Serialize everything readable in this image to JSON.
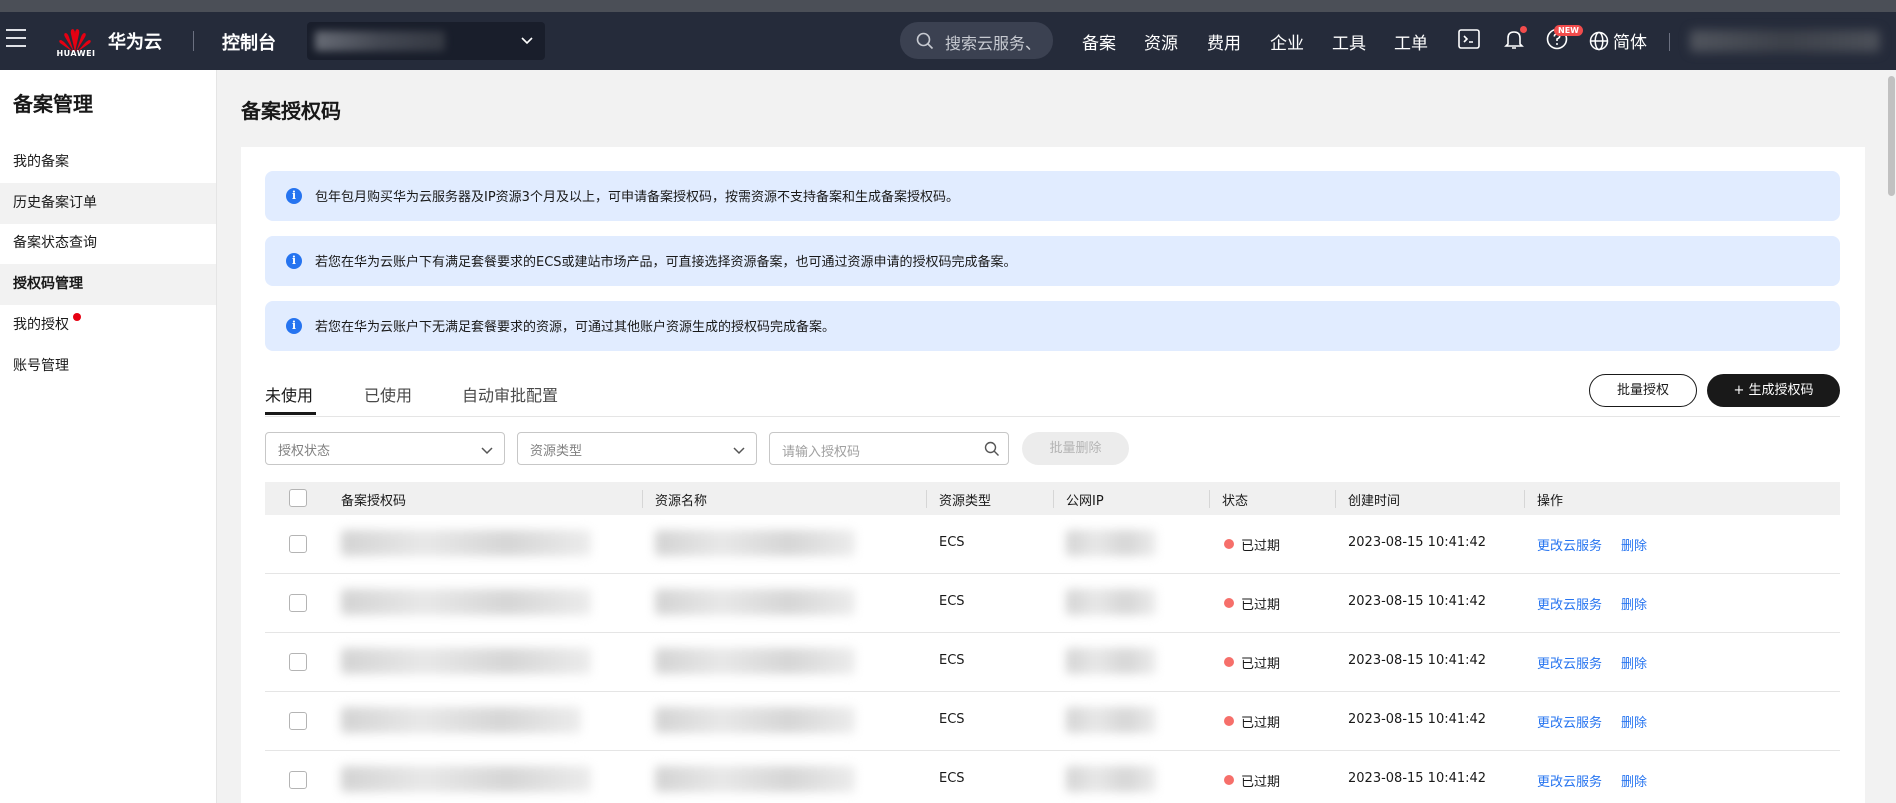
{
  "header": {
    "brand": "华为云",
    "logo_text": "HUAWEI",
    "console": "控制台",
    "search_placeholder": "搜索云服务、",
    "nav": [
      "备案",
      "资源",
      "费用",
      "企业",
      "工具",
      "工单"
    ],
    "new_badge": "NEW",
    "language": "简体"
  },
  "sidebar": {
    "title": "备案管理",
    "items": [
      {
        "label": "我的备案"
      },
      {
        "label": "历史备案订单"
      },
      {
        "label": "备案状态查询"
      },
      {
        "label": "授权码管理"
      },
      {
        "label": "我的授权"
      },
      {
        "label": "账号管理"
      }
    ]
  },
  "main": {
    "title": "备案授权码",
    "banners": [
      "包年包月购买华为云服务器及IP资源3个月及以上，可申请备案授权码，按需资源不支持备案和生成备案授权码。",
      "若您在华为云账户下有满足套餐要求的ECS或建站市场产品，可直接选择资源备案，也可通过资源申请的授权码完成备案。",
      "若您在华为云账户下无满足套餐要求的资源，可通过其他账户资源生成的授权码完成备案。"
    ],
    "info_glyph": "i",
    "tabs": [
      "未使用",
      "已使用",
      "自动审批配置"
    ],
    "batch_authorize": "批量授权",
    "generate_code": "+ 生成授权码",
    "filter_status": "授权状态",
    "filter_type": "资源类型",
    "code_input_placeholder": "请输入授权码",
    "batch_delete": "批量删除",
    "table": {
      "columns": [
        "备案授权码",
        "资源名称",
        "资源类型",
        "公网IP",
        "状态",
        "创建时间",
        "操作"
      ],
      "rows": [
        {
          "type": "ECS",
          "status": "已过期",
          "created": "2023-08-15 10:41:42",
          "action1": "更改云服务",
          "action2": "删除"
        },
        {
          "type": "ECS",
          "status": "已过期",
          "created": "2023-08-15 10:41:42",
          "action1": "更改云服务",
          "action2": "删除"
        },
        {
          "type": "ECS",
          "status": "已过期",
          "created": "2023-08-15 10:41:42",
          "action1": "更改云服务",
          "action2": "删除"
        },
        {
          "type": "ECS",
          "status": "已过期",
          "created": "2023-08-15 10:41:42",
          "action1": "更改云服务",
          "action2": "删除"
        },
        {
          "type": "ECS",
          "status": "已过期",
          "created": "2023-08-15 10:41:42",
          "action1": "更改云服务",
          "action2": "删除"
        }
      ]
    }
  },
  "colors": {
    "header_bg": "#252b3a",
    "link": "#2674f0",
    "banner_bg": "#e1ecff",
    "expired_dot": "#f66f6a",
    "primary_button": "#191919"
  }
}
